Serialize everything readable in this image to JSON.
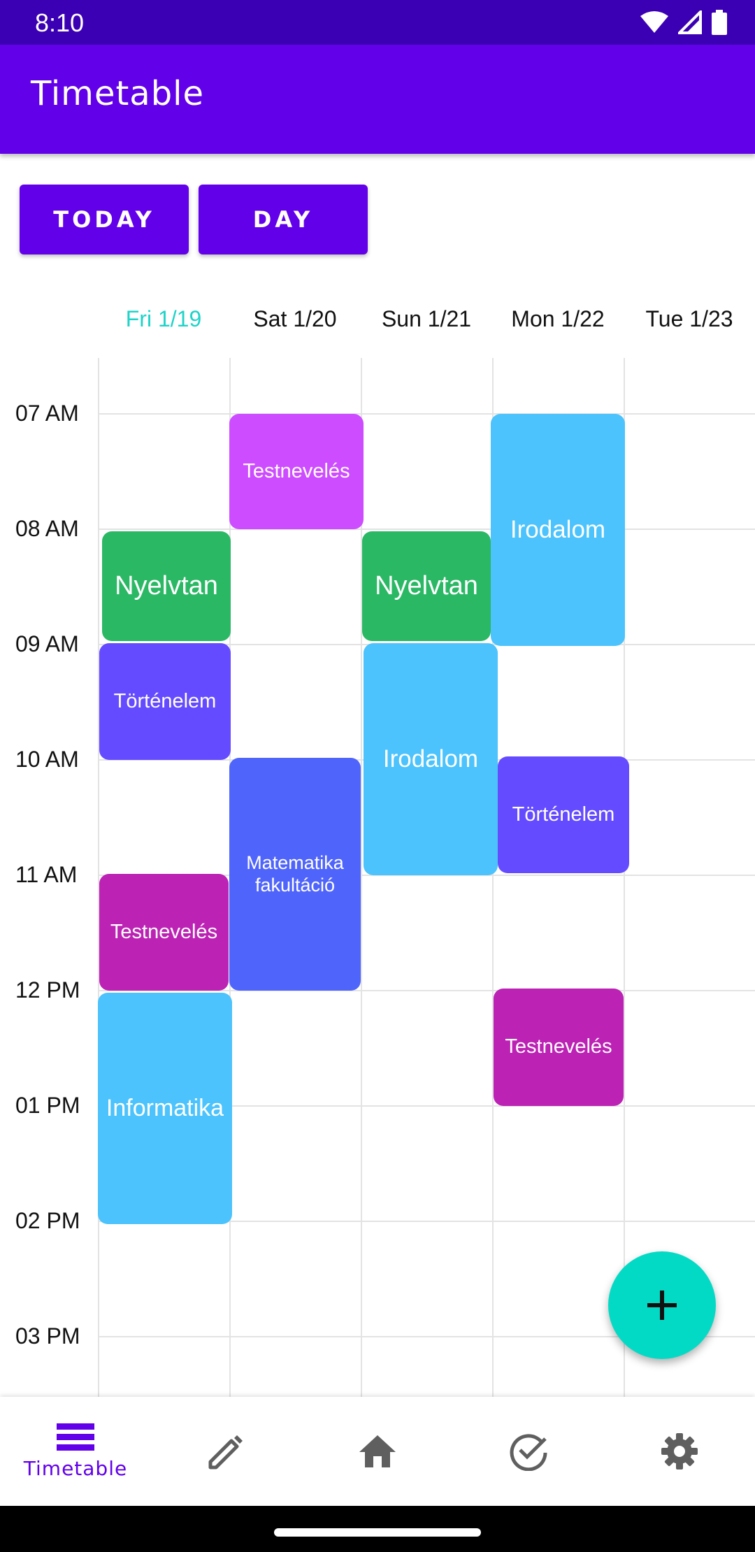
{
  "status_bar": {
    "time": "8:10"
  },
  "app_bar": {
    "title": "Timetable"
  },
  "toolbar": {
    "today_label": "TODAY",
    "day_label": "DAY"
  },
  "days": [
    {
      "label": "Fri 1/19",
      "is_today": true
    },
    {
      "label": "Sat 1/20",
      "is_today": false
    },
    {
      "label": "Sun 1/21",
      "is_today": false
    },
    {
      "label": "Mon 1/22",
      "is_today": false
    },
    {
      "label": "Tue 1/23",
      "is_today": false
    }
  ],
  "times": [
    "07 AM",
    "08 AM",
    "09 AM",
    "10 AM",
    "11 AM",
    "12 PM",
    "01 PM",
    "02 PM",
    "03 PM"
  ],
  "events": [
    {
      "day": 0,
      "start": "08:00",
      "end": "09:00",
      "title": "Nyelvtan",
      "color": "#2bb865"
    },
    {
      "day": 0,
      "start": "09:00",
      "end": "10:00",
      "title": "Történelem",
      "color": "#654bff"
    },
    {
      "day": 0,
      "start": "11:00",
      "end": "12:00",
      "title": "Testnevelés",
      "color": "#bc22b4"
    },
    {
      "day": 0,
      "start": "12:00",
      "end": "14:00",
      "title": "Informatika",
      "color": "#4cc3fc"
    },
    {
      "day": 1,
      "start": "07:00",
      "end": "08:00",
      "title": "Testnevelés",
      "color": "#cd4cff"
    },
    {
      "day": 1,
      "start": "10:00",
      "end": "12:00",
      "title": "Matematika fakultáció",
      "color": "#4f64fb"
    },
    {
      "day": 2,
      "start": "08:00",
      "end": "09:00",
      "title": "Nyelvtan",
      "color": "#2bb865"
    },
    {
      "day": 2,
      "start": "09:00",
      "end": "11:00",
      "title": "Irodalom",
      "color": "#4cc3fc"
    },
    {
      "day": 3,
      "start": "07:00",
      "end": "09:00",
      "title": "Irodalom",
      "color": "#4cc3fc"
    },
    {
      "day": 3,
      "start": "10:00",
      "end": "11:00",
      "title": "Történelem",
      "color": "#654bff"
    },
    {
      "day": 3,
      "start": "12:00",
      "end": "13:00",
      "title": "Testnevelés",
      "color": "#bc22b4"
    }
  ],
  "fab": {
    "icon": "plus-icon",
    "color": "#03dac5"
  },
  "bottom_nav": [
    {
      "icon": "timetable-icon",
      "label": "Timetable",
      "active": true
    },
    {
      "icon": "pencil-icon",
      "label": "",
      "active": false
    },
    {
      "icon": "home-icon",
      "label": "",
      "active": false
    },
    {
      "icon": "check-circle-icon",
      "label": "",
      "active": false
    },
    {
      "icon": "gear-icon",
      "label": "",
      "active": false
    }
  ],
  "colors": {
    "primary": "#6200ea",
    "status_bar": "#3b00b3",
    "accent": "#03dac5",
    "today_header": "#1ed3c9"
  }
}
